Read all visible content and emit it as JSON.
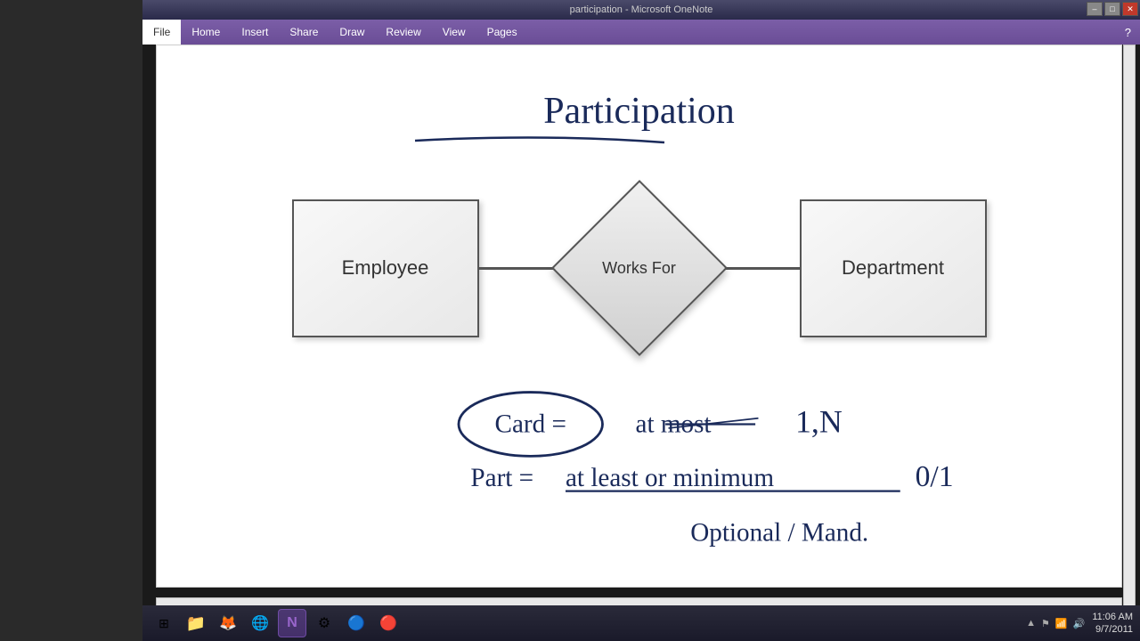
{
  "titlebar": {
    "title": "participation - Microsoft OneNote",
    "minimize": "–",
    "maximize": "□",
    "close": "✕"
  },
  "ribbon": {
    "tabs": [
      "File",
      "Home",
      "Insert",
      "Share",
      "Draw",
      "Review",
      "View",
      "Pages"
    ],
    "active_tab": "File",
    "help_label": "?"
  },
  "diagram": {
    "title": "Participation",
    "entity_left": "Employee",
    "relationship": "Works For",
    "entity_right": "Department"
  },
  "annotations": {
    "line1": "Cards = at most   1,N",
    "line2": "Part = at least or minimum   0/1",
    "line3": "Optional / Mand."
  },
  "taskbar": {
    "icons": [
      "⊞",
      "📁",
      "🦊",
      "🌐",
      "📝",
      "⚙",
      "🔵",
      "🔴"
    ],
    "time": "11:06 AM",
    "date": "9/7/2011"
  }
}
